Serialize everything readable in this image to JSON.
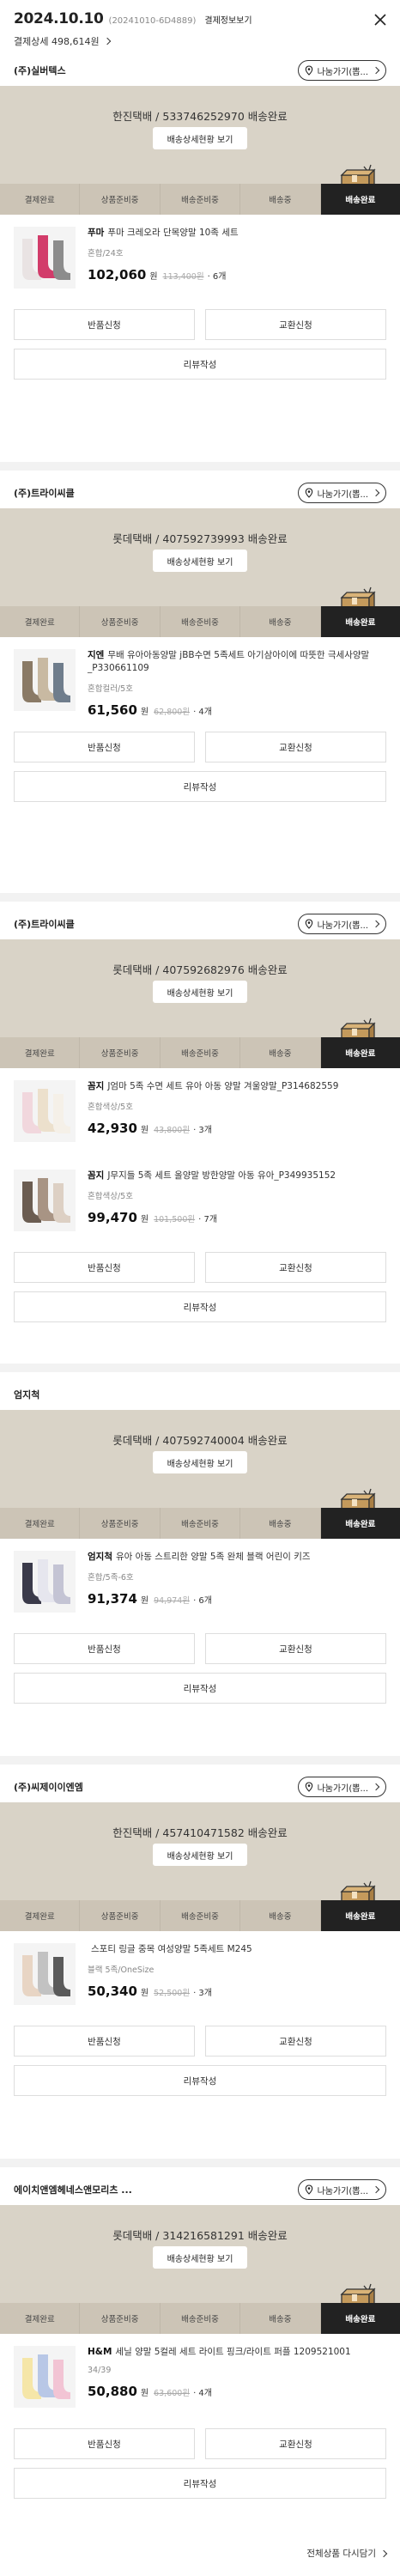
{
  "header": {
    "date": "2024.10.10",
    "order_no": "(20241010-6D4889)",
    "detail_link": "결제정보보기",
    "payment_amount": "결제상세 498,614원"
  },
  "common": {
    "share_label": "나눔가기(뽑...",
    "detail_button": "배송상세현황 보기",
    "steps": [
      "결제완료",
      "상품준비중",
      "배송준비중",
      "배송중",
      "배송완료"
    ],
    "return_label": "반품신청",
    "exchange_label": "교환신청",
    "review_label": "리뷰작성",
    "won": "원"
  },
  "orders": [
    {
      "seller": "(주)실버텍스",
      "tracking": "한진택배 / 533746252970 배송완료",
      "show_share": true,
      "items": [
        {
          "brand": "푸마",
          "name": "푸마 크레오라 단목양말 10족 세트",
          "option": "혼합/24호",
          "price": "102,060",
          "original": "113,400원",
          "qty": "· 6개"
        }
      ]
    },
    {
      "seller": "(주)트라이씨클",
      "tracking": "롯데택배 / 407592739993 배송완료",
      "show_share": true,
      "items": [
        {
          "brand": "지엔",
          "name": "무배 유아아동양말 jBB수면 5족세트 아기삼아이에 따뜻한 극세사양말_P330661109",
          "option": "혼합컬러/5호",
          "price": "61,560",
          "original": "62,800원",
          "qty": "· 4개"
        }
      ]
    },
    {
      "seller": "(주)트라이씨클",
      "tracking": "롯데택배 / 407592682976 배송완료",
      "show_share": true,
      "items": [
        {
          "brand": "꼼지",
          "name": "J엄마 5족 수면 세트 유아 아동 양말 겨울양말_P314682559",
          "option": "혼합색상/5호",
          "price": "42,930",
          "original": "43,800원",
          "qty": "· 3개"
        },
        {
          "brand": "꼼지",
          "name": "J무지들 5족 세트 올양말 방한양말 아동 유아_P349935152",
          "option": "혼합색상/5호",
          "price": "99,470",
          "original": "101,500원",
          "qty": "· 7개"
        }
      ]
    },
    {
      "seller": "엄지척",
      "tracking": "롯데택배 / 407592740004 배송완료",
      "show_share": false,
      "items": [
        {
          "brand": "엄지척",
          "name": "유아 아동 스트리한 양말 5족 완체 블랙 어린이 키즈",
          "option": "혼합/5족-6호",
          "price": "91,374",
          "original": "94,974원",
          "qty": "· 6개"
        }
      ]
    },
    {
      "seller": "(주)씨제이이엔엠",
      "tracking": "한진택배 / 457410471582 배송완료",
      "show_share": true,
      "items": [
        {
          "brand": "",
          "name": "스포티 링글 중목 여성양말 5족세트 M245",
          "option": "블랙 5족/OneSize",
          "price": "50,340",
          "original": "52,500원",
          "qty": "· 3개"
        }
      ]
    },
    {
      "seller": "에이치앤엠헤네스앤모리츠 ...",
      "tracking": "롯데택배 / 314216581291 배송완료",
      "show_share": true,
      "items": [
        {
          "brand": "H&M",
          "name": "세닐 양말 5컬레 세트 라이트 핑크/라이트 퍼플 1209521001",
          "option": "34/39",
          "price": "50,880",
          "original": "63,600원",
          "qty": "· 4개"
        }
      ]
    }
  ],
  "footer": {
    "all_products_link": "전체상품 다시담기"
  },
  "colors": {
    "status_bg": "#d9d3c7",
    "active_step": "#222222",
    "step_bg": "#ccc4b6"
  }
}
